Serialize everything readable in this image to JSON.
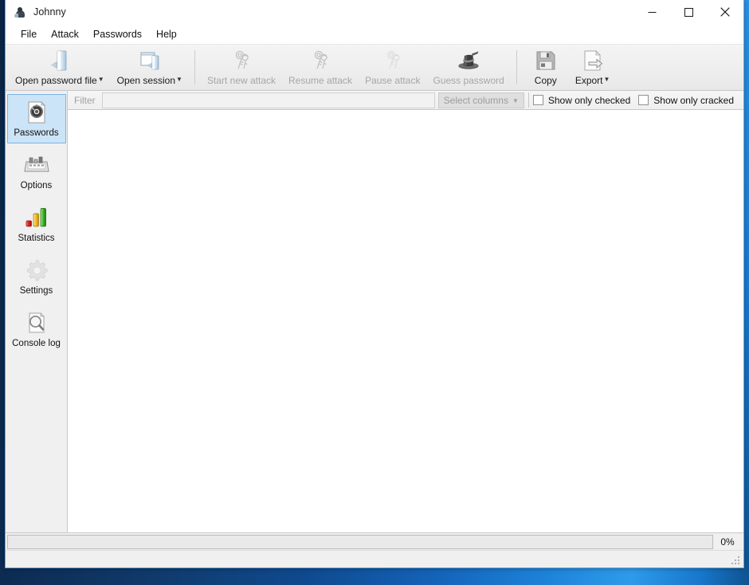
{
  "window": {
    "title": "Johnny",
    "app_icon": "johnny-ant-icon",
    "controls": {
      "minimize": "minimize-icon",
      "maximize": "maximize-icon",
      "close": "close-icon"
    }
  },
  "menubar": {
    "items": [
      {
        "label": "File"
      },
      {
        "label": "Attack"
      },
      {
        "label": "Passwords"
      },
      {
        "label": "Help"
      }
    ]
  },
  "toolbar": {
    "buttons": [
      {
        "label": "Open password file",
        "icon": "open-file-icon",
        "enabled": true,
        "has_dropdown": true
      },
      {
        "label": "Open session",
        "icon": "open-session-icon",
        "enabled": true,
        "has_dropdown": true
      },
      {
        "label": "Start new attack",
        "icon": "keys-icon",
        "enabled": false,
        "has_dropdown": false
      },
      {
        "label": "Resume attack",
        "icon": "keys-resume-icon",
        "enabled": false,
        "has_dropdown": false
      },
      {
        "label": "Pause attack",
        "icon": "keys-pause-icon",
        "enabled": false,
        "has_dropdown": false
      },
      {
        "label": "Guess password",
        "icon": "magic-hat-icon",
        "enabled": false,
        "has_dropdown": false
      },
      {
        "label": "Copy",
        "icon": "floppy-disk-icon",
        "enabled": true,
        "has_dropdown": false
      },
      {
        "label": "Export",
        "icon": "export-arrow-icon",
        "enabled": true,
        "has_dropdown": true
      }
    ]
  },
  "sidebar": {
    "items": [
      {
        "label": "Passwords",
        "icon": "password-dial-icon",
        "selected": true
      },
      {
        "label": "Options",
        "icon": "options-panel-icon",
        "selected": false
      },
      {
        "label": "Statistics",
        "icon": "bar-chart-icon",
        "selected": false
      },
      {
        "label": "Settings",
        "icon": "gear-icon",
        "selected": false
      },
      {
        "label": "Console log",
        "icon": "magnifier-document-icon",
        "selected": false
      }
    ]
  },
  "filterbar": {
    "filter_label": "Filter",
    "filter_value": "",
    "filter_placeholder": "",
    "select_columns_label": "Select columns",
    "select_columns_caret": "▼",
    "checkboxes": [
      {
        "label": "Show only checked",
        "checked": false
      },
      {
        "label": "Show only cracked",
        "checked": false
      }
    ]
  },
  "table": {
    "rows": []
  },
  "progress": {
    "percent_label": "0%",
    "percent_value": 0
  },
  "statusbar": {
    "text": "",
    "grip": "resize-grip-icon"
  },
  "colors": {
    "selection_bg": "#cce4f7",
    "selection_border": "#7eb4e2",
    "toolbar_bg": "#eeeeee",
    "disabled_text": "#a6a6a6",
    "desktop_blue": "#1463b8"
  }
}
